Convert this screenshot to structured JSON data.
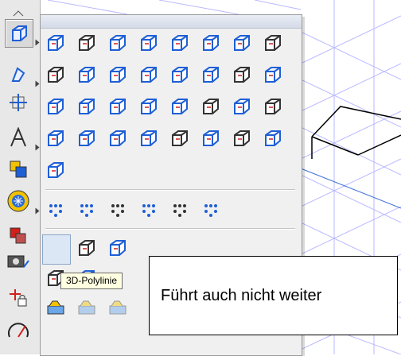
{
  "tooltip": {
    "text": "3D-Polylinie"
  },
  "annotation": {
    "text": "Führt auch nicht weiter"
  },
  "colors": {
    "accent_blue": "#1e5fd6",
    "accent_red": "#d0201a",
    "accent_yellow": "#f2c200",
    "background_grid": "#b9b9ff"
  },
  "left_toolbar": {
    "tools": [
      {
        "icon": "cube-wire-icon"
      },
      {
        "icon": "pen-draw-icon"
      },
      {
        "icon": "move-cross-icon"
      },
      {
        "icon": "text-letter-icon"
      },
      {
        "icon": "shape-copy-icon"
      },
      {
        "icon": "globe-ball-icon"
      },
      {
        "icon": "layers-stack-icon"
      },
      {
        "icon": "camera-icon"
      },
      {
        "icon": "snap-lock-icon"
      },
      {
        "icon": "measure-dial-icon"
      }
    ]
  },
  "flyout": {
    "rows": [
      [
        "box-icon",
        "sphere-frame-icon",
        "torus-icon",
        "cone-icon",
        "wedge-icon",
        "pyramid-icon",
        "prism-icon",
        "spring-icon"
      ],
      [
        "cylinder-icon",
        "drum-icon",
        "slab-icon",
        "chalice-icon",
        "dome-icon",
        "ring-block-icon",
        "washer-icon",
        "grid-block-icon"
      ],
      [
        "roof-icon",
        "frustum-icon",
        "pin-icon",
        "ibeam-icon",
        "bracket-icon",
        "frame-box-icon",
        "saddle-icon",
        "rounded-cube-icon"
      ],
      [
        "channel-icon",
        "plane-slice-icon",
        "stack-dots-icon",
        "barrel-icon",
        "screw-icon",
        "elbow-pipe-icon",
        "sphere-cut-icon",
        "bar-icon"
      ],
      [
        "tray-icon"
      ],
      [
        "dots-grid-icon",
        "arc-points-icon",
        "frame-points-icon",
        "circle-points-icon",
        "diamond-points-icon",
        "cross-points-icon"
      ],
      [
        "3d-polyline-icon",
        "3d-surface-icon",
        "3d-curve-icon"
      ],
      [
        "spiral-icon",
        "helix-icon"
      ],
      [
        "group-open-icon",
        "group-cycle-icon",
        "group-settings-icon"
      ]
    ]
  }
}
